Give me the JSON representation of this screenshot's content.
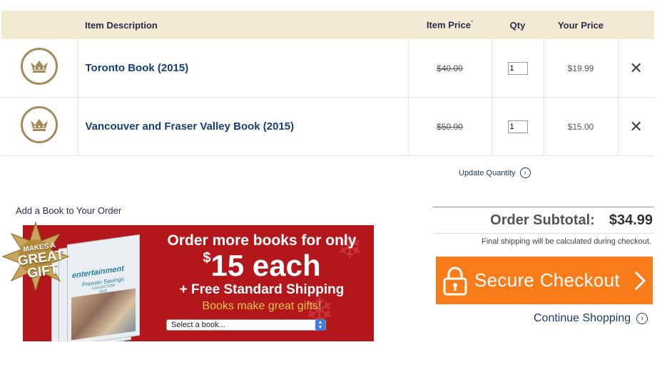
{
  "cart": {
    "headers": {
      "description": "Item Description",
      "item_price": "Item Price",
      "item_price_mark": "*",
      "qty": "Qty",
      "your_price": "Your Price"
    },
    "items": [
      {
        "title": "Toronto Book (2015)",
        "original_price": "$40.00",
        "qty": "1",
        "your_price": "$19.99",
        "icon": "crown-icon",
        "remove_icon": "close-icon"
      },
      {
        "title": "Vancouver and Fraser Valley Book (2015)",
        "original_price": "$50.00",
        "qty": "1",
        "your_price": "$15.00",
        "icon": "crown-icon",
        "remove_icon": "close-icon"
      }
    ],
    "update_quantity_label": "Update Quantity"
  },
  "promo": {
    "section_label": "Add a Book to Your Order",
    "badge_line1": "MAKES A",
    "badge_line2": "GREAT",
    "badge_line3": "GIFT",
    "line1": "Order more books for only",
    "price_symbol": "$",
    "price_text": "15 each",
    "line3": "+ Free Standard Shipping",
    "line4": "Books make great gifts!",
    "select_value": "Select a book...",
    "book_cover_brand": "entertainment",
    "book_cover_sub": "Premier Savings",
    "book_cover_collection": "COLLECTION",
    "book_cover_year": "2015"
  },
  "summary": {
    "subtotal_label": "Order Subtotal:",
    "subtotal_value": "$34.99",
    "shipping_note": "Final shipping will be calculated during checkout.",
    "checkout_label": "Secure Checkout",
    "continue_label": "Continue Shopping"
  },
  "colors": {
    "header_bg": "#f1e9d2",
    "title_blue": "#153f78",
    "crown_gold": "#a6895a",
    "promo_red": "#b3171c",
    "promo_gold_text": "#f2c84b",
    "checkout_orange": "#f87d1a"
  }
}
